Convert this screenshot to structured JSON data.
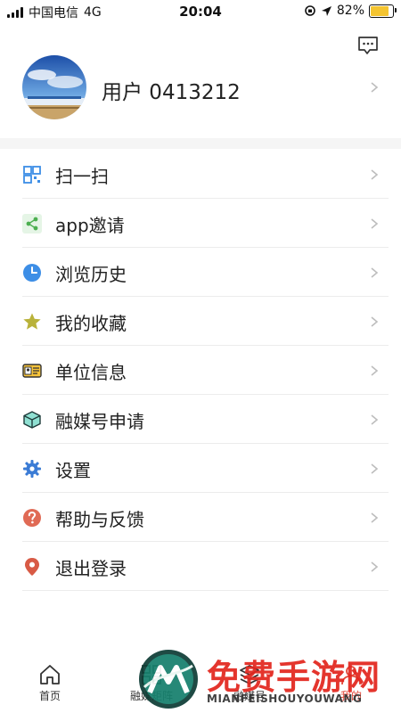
{
  "status_bar": {
    "carrier": "中国电信",
    "network": "4G",
    "time": "20:04",
    "battery": "82%",
    "battery_level": 0.82
  },
  "header": {
    "message_icon": "chat-bubble-icon"
  },
  "profile": {
    "username": "用户 0413212"
  },
  "menu": {
    "items": [
      {
        "label": "扫一扫",
        "icon": "qr-scan-icon"
      },
      {
        "label": "app邀请",
        "icon": "share-icon"
      },
      {
        "label": "浏览历史",
        "icon": "clock-icon"
      },
      {
        "label": "我的收藏",
        "icon": "star-icon"
      },
      {
        "label": "单位信息",
        "icon": "id-card-icon"
      },
      {
        "label": "融媒号申请",
        "icon": "cube-icon"
      },
      {
        "label": "设置",
        "icon": "gear-icon"
      },
      {
        "label": "帮助与反馈",
        "icon": "question-icon"
      },
      {
        "label": "退出登录",
        "icon": "location-pin-icon"
      }
    ]
  },
  "tabbar": {
    "tabs": [
      {
        "label": "首页",
        "icon": "home-icon",
        "active": false
      },
      {
        "label": "融媒矩阵",
        "icon": "grid-icon",
        "active": false
      },
      {
        "label": "融媒号",
        "icon": "layers-icon",
        "active": false
      },
      {
        "label": "我的",
        "icon": "user-icon",
        "active": true
      }
    ]
  },
  "watermark": {
    "title": "免费手游网",
    "subtitle": "MIANFEISHOUYOUWANG"
  },
  "colors": {
    "accent": "#e24a3b",
    "battery": "#f4c430",
    "share_green": "#4caf50",
    "clock_blue": "#3d8ee6",
    "star_olive": "#b9b23a",
    "cube_teal": "#2bb7a6",
    "gear_blue": "#3a7bd5",
    "help_red": "#e06a55",
    "logout_red": "#d85a45"
  }
}
